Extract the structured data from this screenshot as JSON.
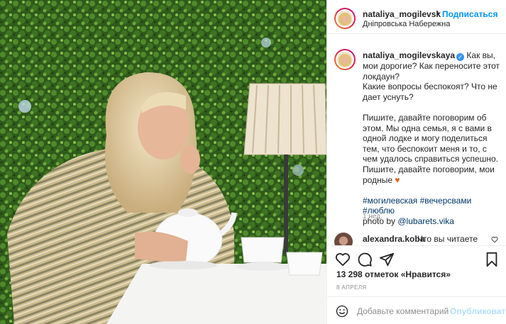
{
  "post": {
    "photo": {
      "description_icon": "photo"
    },
    "header": {
      "username": "nataliya_mogilevsk",
      "separator": "•",
      "follow_label": "Подписаться",
      "location": "Дніпровська Набережна"
    },
    "caption": {
      "author": "nataliya_mogilevskaya",
      "verified_mark": "✓",
      "lines_1": "Как вы, мои дорогие? Как переносите этот локдаун?",
      "lines_2": "Какие вопросы беспокоят? Что не дает уснуть?",
      "lines_3": "Пишите, давайте поговорим об этом. Мы одна семья, я с вами в одной лодке и могу поделиться тем, что беспокоит меня и то, с чем удалось справиться успешно. Пишите, давайте поговорим, мои родные",
      "heart": "♥",
      "hashtags": "#могилевская #вечерсвами #люблю",
      "photo_by_prefix": "photo by ",
      "photo_by_mention": "@lubarets.vika",
      "time": "1 нед."
    },
    "comment": {
      "user": "alexandra.koba",
      "text": "Что вы читаете"
    },
    "actions": {
      "like_icon": "heart-icon",
      "comment_icon": "comment-icon",
      "share_icon": "share-icon",
      "save_icon": "bookmark-icon"
    },
    "likes_text": "13 298 отметок «Нравится»",
    "date": "8 АПРЕЛЯ",
    "add_comment": {
      "placeholder": "Добавьте комментарий...",
      "publish_label": "Опубликовать"
    }
  },
  "colors": {
    "link_blue": "#0095f6",
    "publish_disabled": "#b2dffc",
    "muted": "#8e8e8e",
    "text": "#262626",
    "hashtag": "#00376b"
  }
}
